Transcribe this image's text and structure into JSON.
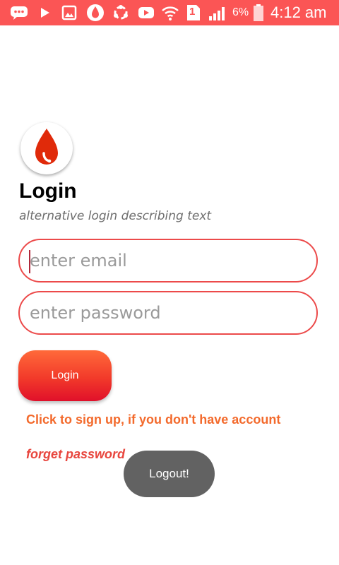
{
  "status_bar": {
    "battery_percent": "6%",
    "time": "4:12 am",
    "sim_slot": "1",
    "icons": [
      "messages-icon",
      "play-store-icon",
      "gallery-icon",
      "blood-drop-app-icon",
      "sync-icon",
      "youtube-icon",
      "wifi-icon",
      "sim-1-icon",
      "signal-icon",
      "battery-icon"
    ],
    "background_color": "#fb5555"
  },
  "app": {
    "logo_icon": "blood-drop-phone-icon",
    "title": "Login",
    "subtitle": "alternative login describing text"
  },
  "form": {
    "email": {
      "value": "",
      "placeholder": "enter email"
    },
    "password": {
      "value": "",
      "placeholder": "enter password"
    },
    "login_label": "Login",
    "signup_text": "Click to sign up, if you don't have account",
    "forget_text": "forget password"
  },
  "toast": {
    "message": "Logout!"
  },
  "colors": {
    "accent": "#ec4a4a",
    "link_orange": "#f36a2c",
    "link_red": "#e8463e",
    "toast_bg": "#626262"
  }
}
